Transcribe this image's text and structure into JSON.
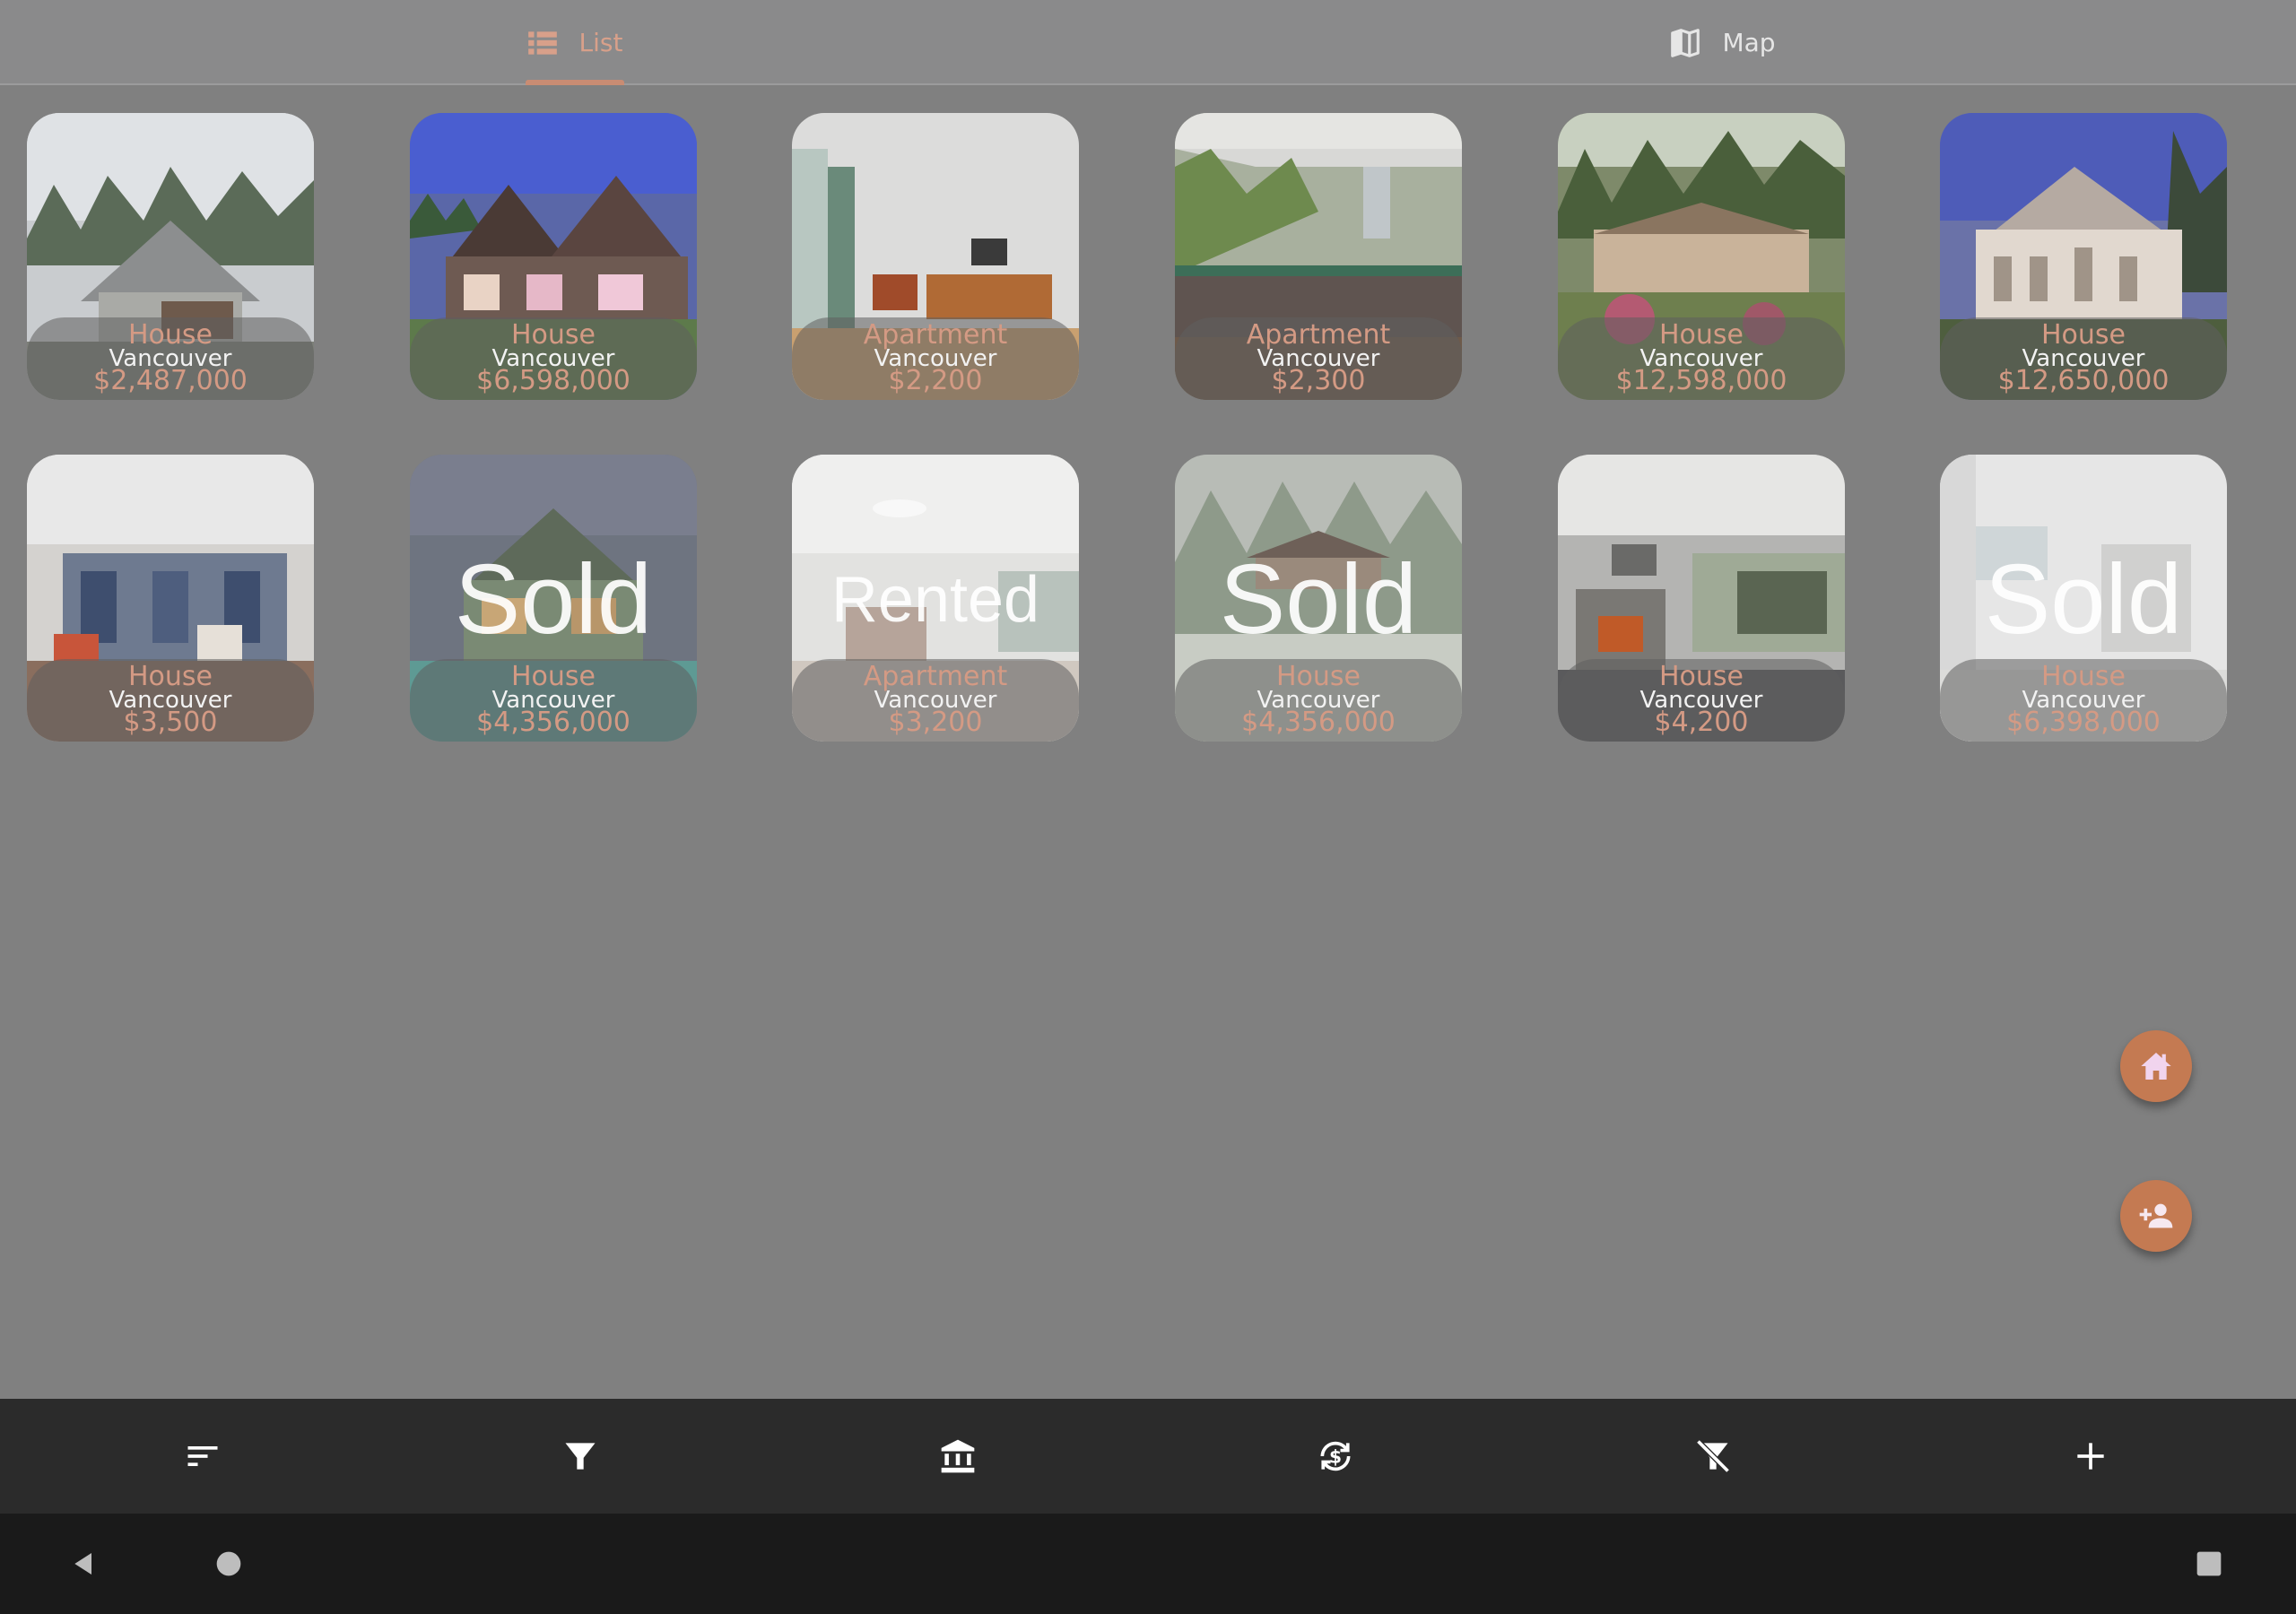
{
  "tabs": {
    "list_label": "List",
    "map_label": "Map",
    "list_icon": "list-icon",
    "map_icon": "map-icon",
    "active": "List"
  },
  "listings": [
    {
      "type": "House",
      "city": "Vancouver",
      "price": "$2,487,000",
      "status": "",
      "photo": "house-exterior-gray"
    },
    {
      "type": "House",
      "city": "Vancouver",
      "price": "$6,598,000",
      "status": "",
      "photo": "house-exterior-dusk"
    },
    {
      "type": "Apartment",
      "city": "Vancouver",
      "price": "$2,200",
      "status": "",
      "photo": "apartment-interior-white"
    },
    {
      "type": "Apartment",
      "city": "Vancouver",
      "price": "$2,300",
      "status": "",
      "photo": "apartment-balcony-trees"
    },
    {
      "type": "House",
      "city": "Vancouver",
      "price": "$12,598,000",
      "status": "",
      "photo": "mansion-garden"
    },
    {
      "type": "House",
      "city": "Vancouver",
      "price": "$12,650,000",
      "status": "",
      "photo": "mansion-white-blue-sky"
    },
    {
      "type": "House",
      "city": "Vancouver",
      "price": "$3,500",
      "status": "",
      "photo": "living-room-red-chairs"
    },
    {
      "type": "House",
      "city": "Vancouver",
      "price": "$4,356,000",
      "status": "Sold",
      "photo": "house-night-pool"
    },
    {
      "type": "Apartment",
      "city": "Vancouver",
      "price": "$3,200",
      "status": "Rented",
      "photo": "apartment-bright-room"
    },
    {
      "type": "House",
      "city": "Vancouver",
      "price": "$4,356,000",
      "status": "Sold",
      "photo": "house-in-forest"
    },
    {
      "type": "House",
      "city": "Vancouver",
      "price": "$4,200",
      "status": "",
      "photo": "living-room-fireplace"
    },
    {
      "type": "House",
      "city": "Vancouver",
      "price": "$6,398,000",
      "status": "Sold",
      "photo": "interior-white-hall"
    }
  ],
  "fabs": [
    {
      "icon": "home-icon"
    },
    {
      "icon": "add-person-icon"
    }
  ],
  "toolbar": [
    {
      "icon": "sort-icon"
    },
    {
      "icon": "filter-icon"
    },
    {
      "icon": "bank-icon"
    },
    {
      "icon": "currency-exchange-icon"
    },
    {
      "icon": "filter-off-icon"
    },
    {
      "icon": "add-icon"
    }
  ],
  "navbar": [
    {
      "icon": "back-icon"
    },
    {
      "icon": "home-circle-icon"
    },
    {
      "icon": "recents-icon"
    }
  ],
  "colors": {
    "accent": "#c47a52",
    "caption_accent": "#d49a84",
    "background": "#808080",
    "tabbar": "#8a8a8b",
    "toolbar": "#2b2b2b",
    "navbar": "#1a1a1a"
  }
}
